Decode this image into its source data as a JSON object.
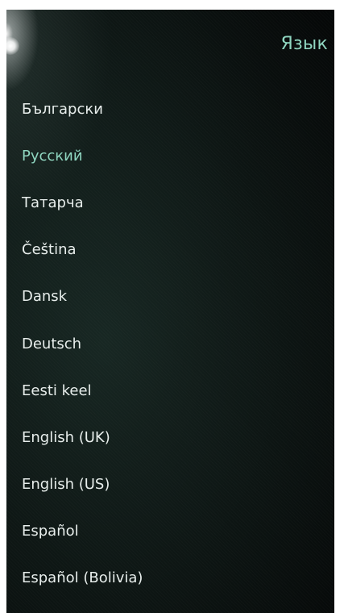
{
  "header": {
    "title": "Язык"
  },
  "colors": {
    "accent": "#8fd6c0",
    "text": "#e8eeec",
    "background": "#0b1210"
  },
  "languages": {
    "selected": "Русский",
    "items": [
      {
        "label": "Български"
      },
      {
        "label": "Русский"
      },
      {
        "label": "Татарча"
      },
      {
        "label": "Čeština"
      },
      {
        "label": "Dansk"
      },
      {
        "label": "Deutsch"
      },
      {
        "label": "Eesti keel"
      },
      {
        "label": "English (UK)"
      },
      {
        "label": "English (US)"
      },
      {
        "label": "Español"
      },
      {
        "label": "Español (Bolivia)"
      }
    ]
  }
}
